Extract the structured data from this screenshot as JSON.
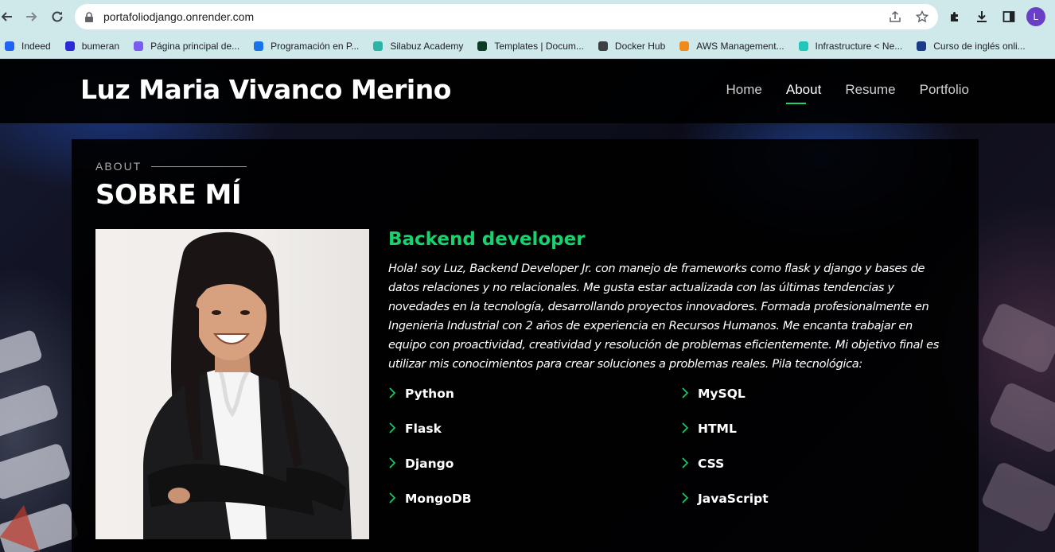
{
  "browser": {
    "url": "portafoliodjango.onrender.com",
    "profile_initial": "L",
    "bookmarks": [
      {
        "label": "Indeed",
        "icon": "indeed-icon",
        "color": "#2164f3"
      },
      {
        "label": "bumeran",
        "icon": "bumeran-icon",
        "color": "#2b2bd6"
      },
      {
        "label": "Página principal de...",
        "icon": "microsoft-365-icon",
        "color": "#7b5cf0"
      },
      {
        "label": "Programación en P...",
        "icon": "course-icon",
        "color": "#1a73e8"
      },
      {
        "label": "Silabuz Academy",
        "icon": "silabuz-icon",
        "color": "#2bb3a6"
      },
      {
        "label": "Templates | Docum...",
        "icon": "django-icon",
        "color": "#0c3c26"
      },
      {
        "label": "Docker Hub",
        "icon": "docker-icon",
        "color": "#3c4043"
      },
      {
        "label": "AWS Management...",
        "icon": "aws-icon",
        "color": "#f08a1c"
      },
      {
        "label": "Infrastructure < Ne...",
        "icon": "netlify-icon",
        "color": "#20c6b7"
      },
      {
        "label": "Curso de inglés onli...",
        "icon": "cambly-icon",
        "color": "#1b3a8a"
      }
    ]
  },
  "site": {
    "title": "Luz Maria Vivanco Merino",
    "nav": [
      "Home",
      "About",
      "Resume",
      "Portfolio"
    ],
    "active_nav": "About",
    "accent_color": "#18d26e"
  },
  "about": {
    "eyebrow": "ABOUT",
    "heading": "SOBRE MÍ",
    "role": "Backend developer",
    "bio": "Hola! soy Luz, Backend Developer Jr. con manejo de frameworks como flask y django y bases de datos relaciones y no relacionales. Me gusta estar actualizada con las últimas tendencias y novedades en la tecnología, desarrollando proyectos innovadores. Formada profesionalmente en Ingenieria Industrial con 2 años de experiencia en Recursos Humanos. Me encanta trabajar en equipo con proactividad, creatividad y resolución de problemas eficientemente. Mi objetivo final es utilizar mis conocimientos para crear soluciones a problemas reales. Pila tecnológica:",
    "skills_left": [
      "Python",
      "Flask",
      "Django",
      "MongoDB"
    ],
    "skills_right": [
      "MySQL",
      "HTML",
      "CSS",
      "JavaScript"
    ]
  }
}
